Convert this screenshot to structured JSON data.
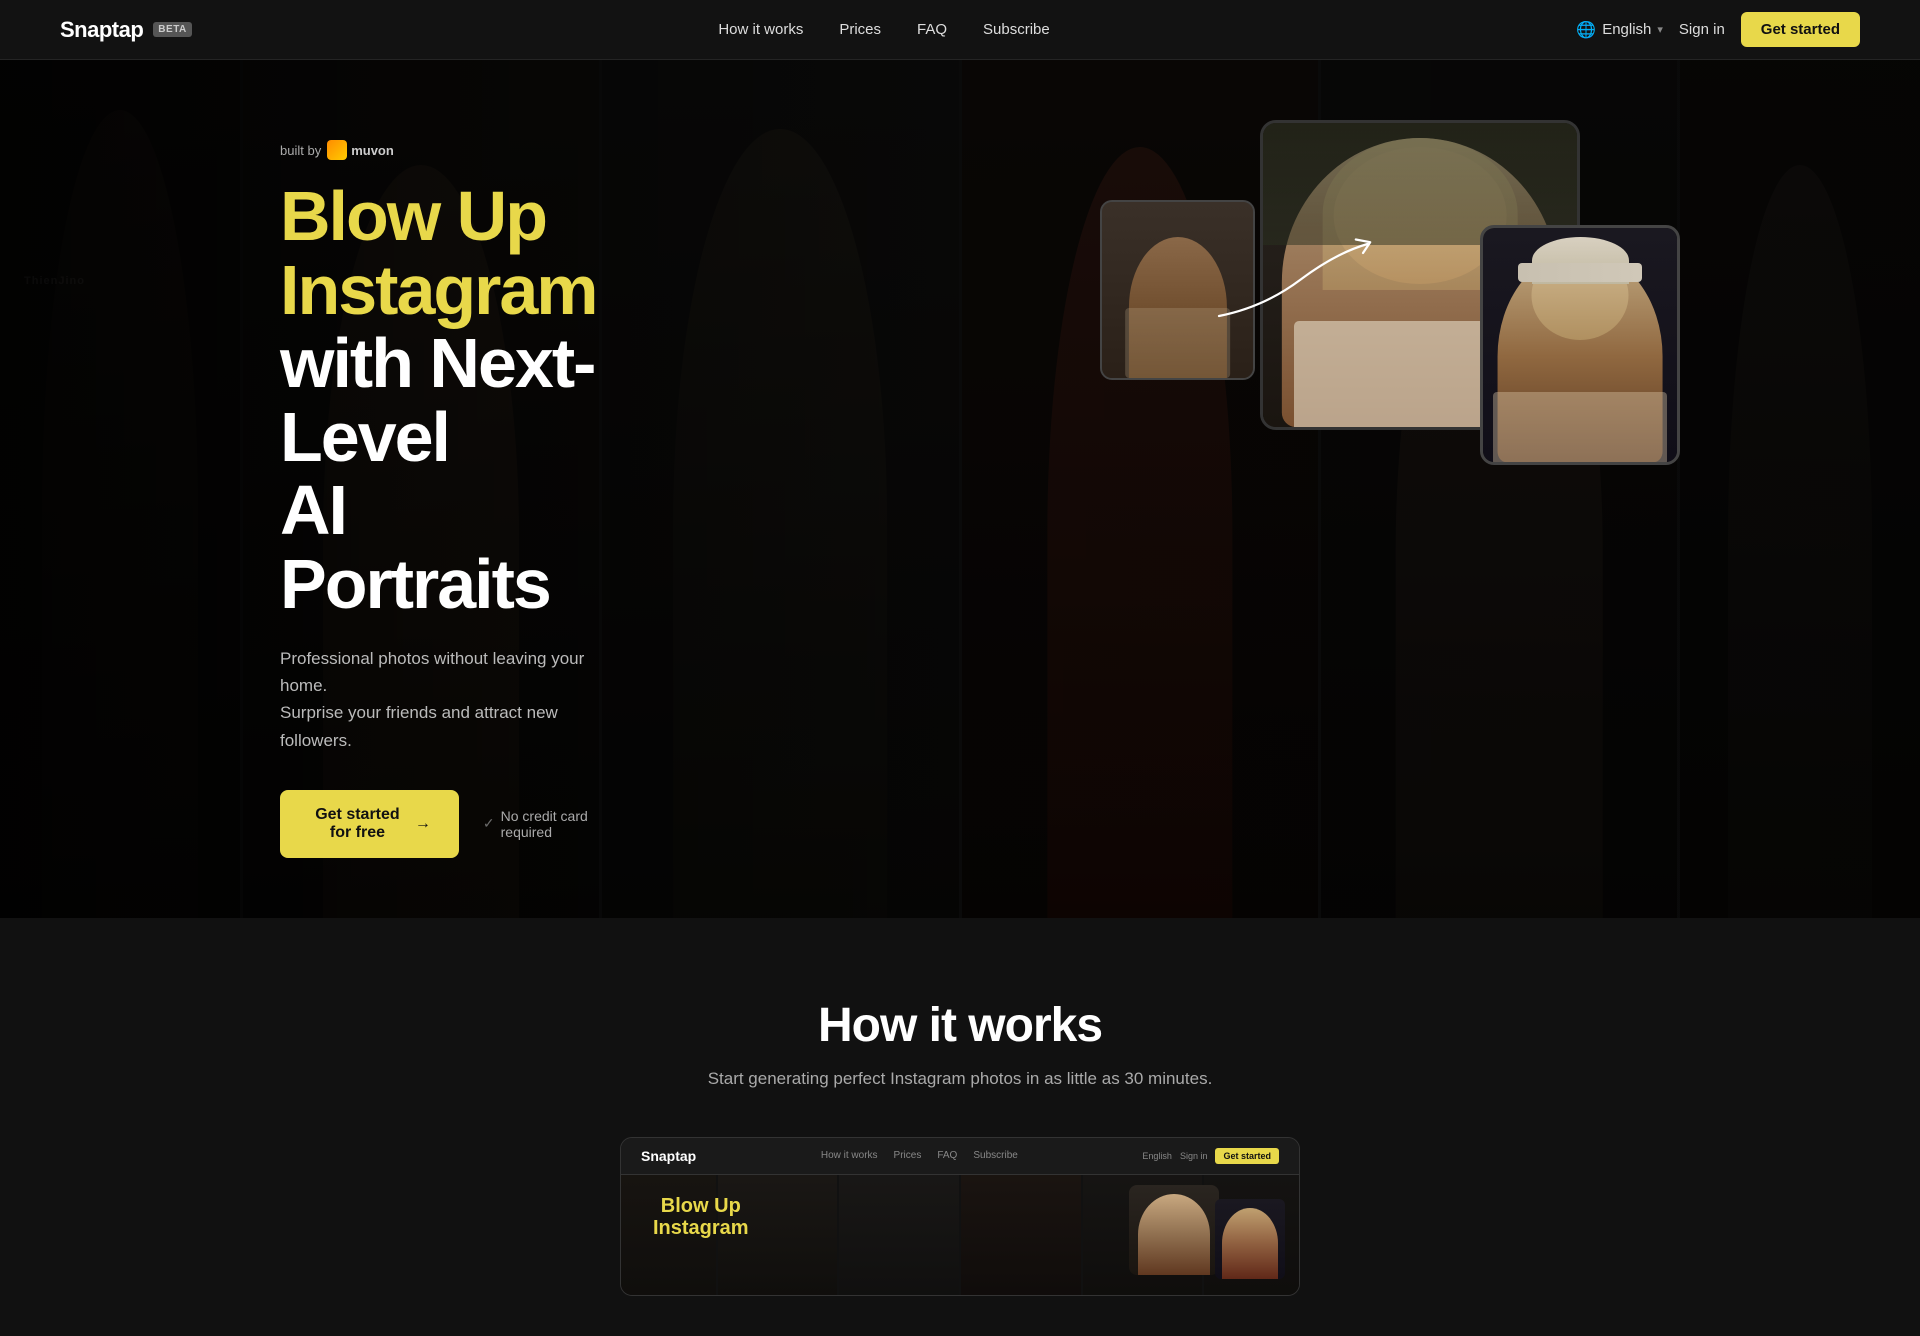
{
  "nav": {
    "logo": "Snaptap",
    "beta": "BETA",
    "links": [
      {
        "label": "How it works",
        "href": "#"
      },
      {
        "label": "Prices",
        "href": "#"
      },
      {
        "label": "FAQ",
        "href": "#"
      },
      {
        "label": "Subscribe",
        "href": "#"
      }
    ],
    "language": "English",
    "sign_in": "Sign in",
    "get_started": "Get started"
  },
  "hero": {
    "built_by_prefix": "built by",
    "built_by_brand": "muvon",
    "headline_line1": "Blow Up",
    "headline_line2": "Instagram",
    "headline_line3": "with Next-Level",
    "headline_line4": "AI Portraits",
    "subtext_line1": "Professional photos without leaving your home.",
    "subtext_line2": "Surprise your friends and attract new followers.",
    "cta_label": "Get started for free",
    "cta_arrow": "→",
    "no_cc": "No credit card required"
  },
  "how_it_works": {
    "title": "How it works",
    "subtitle": "Start generating perfect Instagram photos in as little as 30 minutes.",
    "mini_logo": "Snaptap",
    "mini_links": [
      "How it works",
      "Prices",
      "FAQ",
      "Subscribe"
    ],
    "mini_lang": "English",
    "mini_sign": "Sign in",
    "mini_cta": "Get started",
    "mini_headline": "Blow Up"
  }
}
